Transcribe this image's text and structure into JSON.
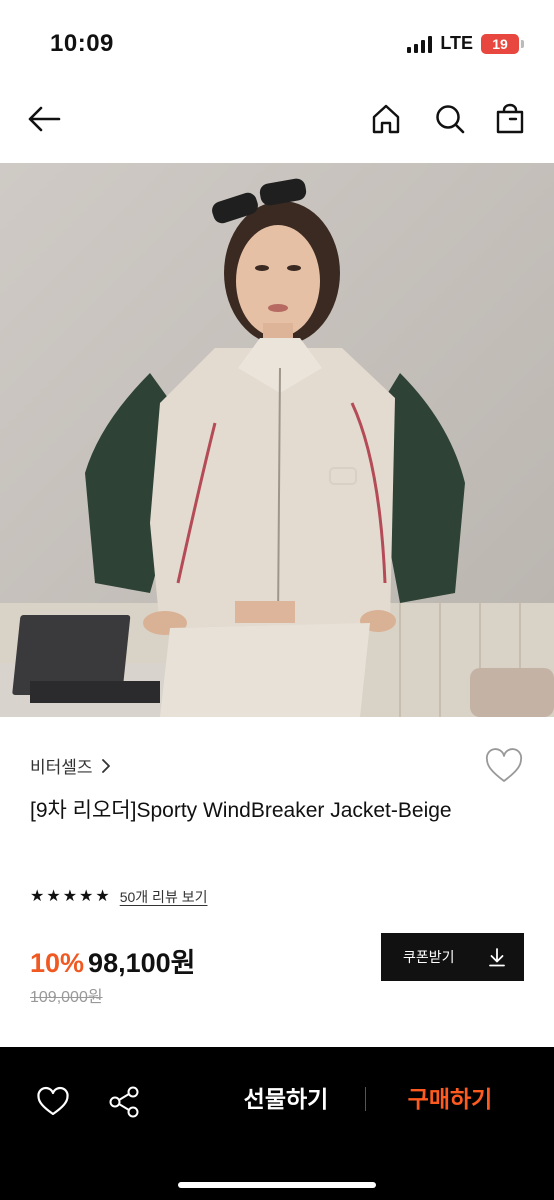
{
  "status": {
    "time": "10:09",
    "network": "LTE",
    "battery": "19",
    "battery_level": 0.19,
    "battery_color": "#e8473f"
  },
  "nav": {
    "back_icon": "arrow-left-icon",
    "home_icon": "home-icon",
    "search_icon": "search-icon",
    "bag_icon": "shopping-bag-icon"
  },
  "product": {
    "brand": "비터셀즈",
    "title": "[9차 리오더]Sporty WindBreaker Jacket-Beige",
    "rating": 5,
    "star_glyph": "★",
    "review_link": "50개 리뷰 보기",
    "discount": "10%",
    "price": "98,100원",
    "original_price": "109,000원",
    "coupon_label": "쿠폰받기"
  },
  "actions": {
    "gift": "선물하기",
    "buy": "구매하기"
  },
  "colors": {
    "accent": "#f05a22",
    "buy": "#ff5a1f",
    "bottom_bar": "#000000"
  }
}
